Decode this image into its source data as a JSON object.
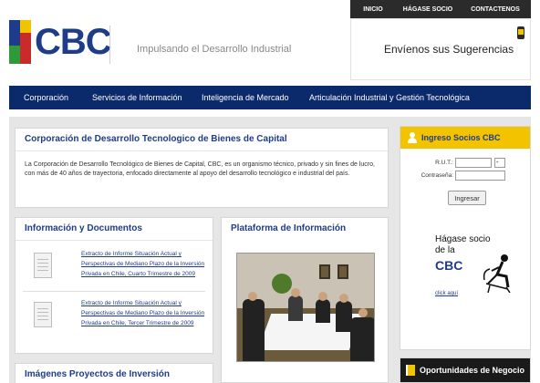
{
  "brand": {
    "logo_text": "CBC",
    "tagline": "Impulsando el Desarrollo Industrial"
  },
  "topnav": {
    "items": [
      "INICIO",
      "HÁGASE SOCIO",
      "CONTACTENOS"
    ]
  },
  "suggestions": {
    "text": "Envíenos sus Sugerencias"
  },
  "mainnav": {
    "items": [
      "Corporación",
      "Servicios de Información",
      "Inteligencia de Mercado",
      "Articulación Industrial y Gestión Tecnológica"
    ]
  },
  "intro": {
    "title": "Corporación de Desarrollo Tecnologico de Bienes de Capital",
    "body": "La Corporación de Desarrollo Tecnológico de Bienes de Capital, CBC, es un organismo técnico, privado y sin fines de lucro, con más de 40 años de trayectoria, enfocado directamente al apoyo del desarrollo tecnológico e industrial del país."
  },
  "documents": {
    "title": "Información y Documentos",
    "items": [
      "Extracto de Informe Situación Actual y Perspectivas de Mediano Plazo de la Inversión Privada en Chile, Cuarto Trimestre de 2009",
      "Extracto de Informe Situación Actual y Perspectivas de Mediano Plazo de la Inversión Privada en Chile, Tercer Trimestre de 2009"
    ]
  },
  "images": {
    "title": "Imágenes Proyectos de Inversión"
  },
  "plataforma": {
    "title": "Plataforma de Información"
  },
  "login": {
    "title": "Ingreso Socios CBC",
    "rut_label": "R.U.T.:",
    "rut_dv_value": "-",
    "password_label": "Contraseña:",
    "submit_label": "Ingresar"
  },
  "promo": {
    "line1": "Hágase socio",
    "line2": "de la",
    "brand": "CBC",
    "link": "click aquí"
  },
  "oportunidades": {
    "label": "Oportunidades de Negocio"
  },
  "colors": {
    "navy": "#0a2a6b",
    "brand_blue": "#1f3c88",
    "accent_yellow": "#f3c300"
  }
}
